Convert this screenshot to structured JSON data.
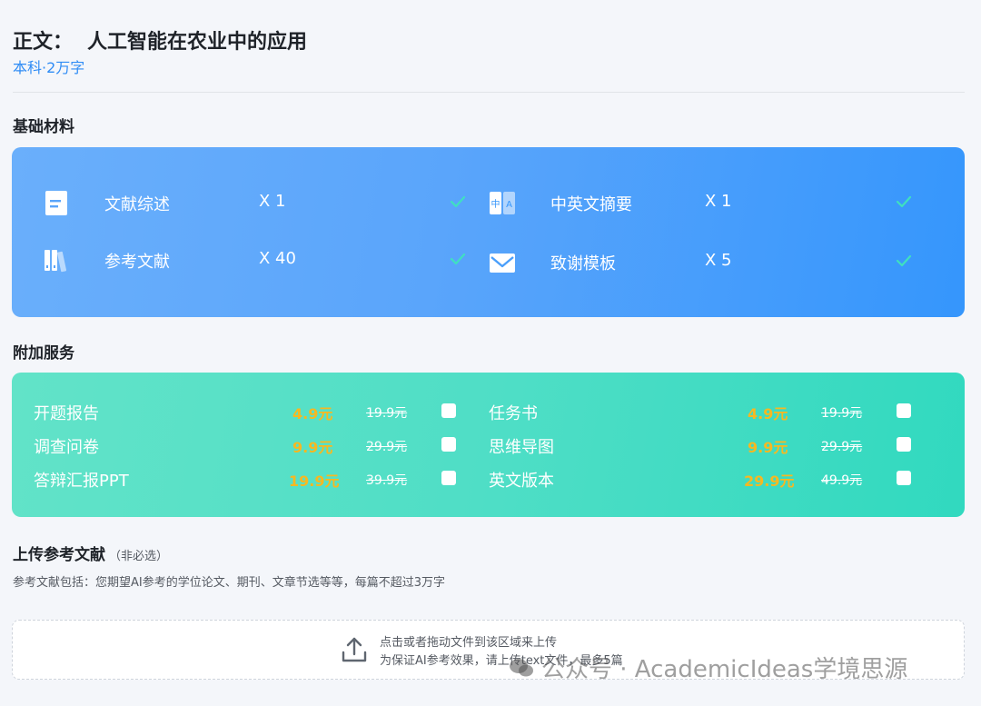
{
  "header": {
    "label": "正文：",
    "title": "人工智能在农业中的应用",
    "subtitle": "本科·2万字"
  },
  "base_section": {
    "label": "基础材料",
    "items": [
      {
        "name": "文献综述",
        "qty": "X 1",
        "icon": "document-icon",
        "checked": true
      },
      {
        "name": "中英文摘要",
        "qty": "X 1",
        "icon": "translate-icon",
        "checked": true
      },
      {
        "name": "参考文献",
        "qty": "X 40",
        "icon": "books-icon",
        "checked": true
      },
      {
        "name": "致谢模板",
        "qty": "X 5",
        "icon": "envelope-icon",
        "checked": true
      }
    ]
  },
  "extra_section": {
    "label": "附加服务",
    "items": [
      {
        "name": "开题报告",
        "price": "4.9元",
        "old_price": "19.9元"
      },
      {
        "name": "任务书",
        "price": "4.9元",
        "old_price": "19.9元"
      },
      {
        "name": "调查问卷",
        "price": "9.9元",
        "old_price": "29.9元"
      },
      {
        "name": "思维导图",
        "price": "9.9元",
        "old_price": "29.9元"
      },
      {
        "name": "答辩汇报PPT",
        "price": "19.9元",
        "old_price": "39.9元"
      },
      {
        "name": "英文版本",
        "price": "29.9元",
        "old_price": "49.9元"
      }
    ]
  },
  "upload": {
    "title": "上传参考文献",
    "optional": "（非必选）",
    "description": "参考文献包括：您期望AI参考的学位论文、期刊、文章节选等等，每篇不超过3万字",
    "drop_line1": "点击或者拖动文件到该区域来上传",
    "drop_line2": "为保证AI参考效果，请上传text文件，最多5篇"
  },
  "watermark": "公众号 · AcademicIdeas学境思源",
  "colors": {
    "accent_blue": "#2f8cf5",
    "price_orange": "#f7b821",
    "check_green": "#3fe0c0"
  }
}
